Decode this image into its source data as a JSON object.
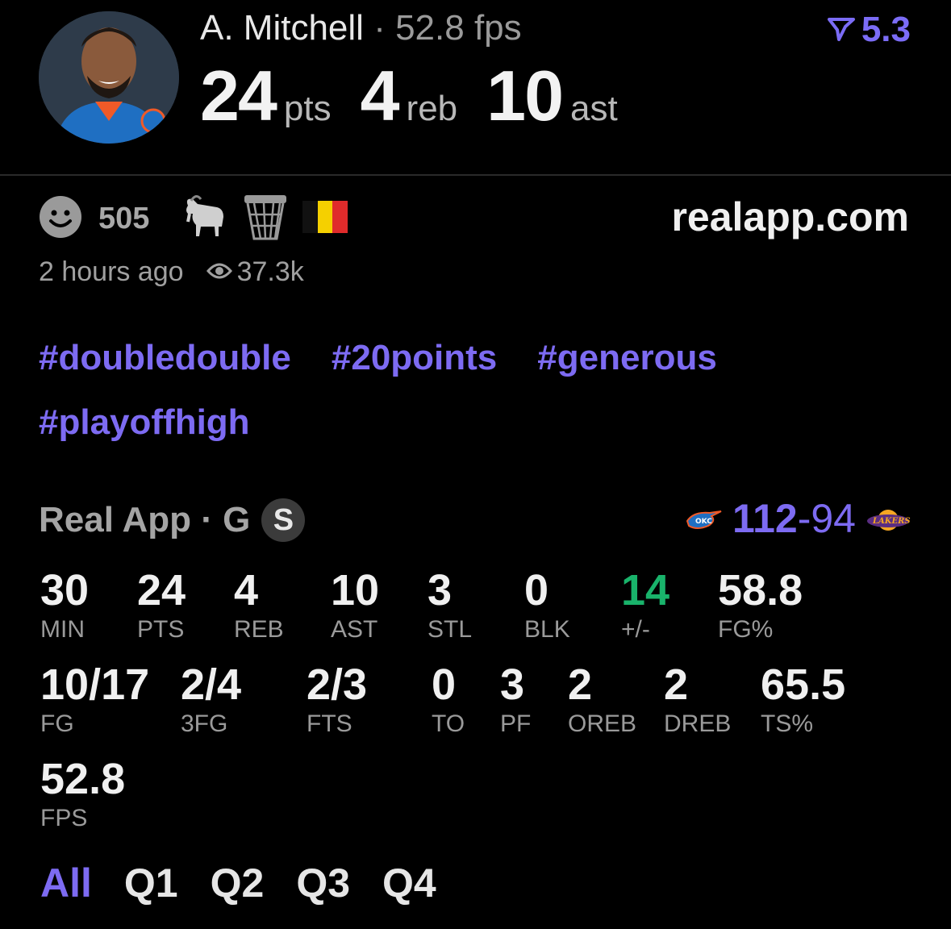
{
  "header": {
    "player_name": "A. Mitchell",
    "separator": "·",
    "fps_text": "52.8 fps",
    "badge_value": "5.3",
    "pts": "24",
    "pts_unit": "pts",
    "reb": "4",
    "reb_unit": "reb",
    "ast": "10",
    "ast_unit": "ast"
  },
  "reactions": {
    "count": "505",
    "icons": [
      "smiley-icon",
      "goat-icon",
      "basketball-hoop-icon",
      "belgium-flag-icon"
    ]
  },
  "site": "realapp.com",
  "meta": {
    "time": "2 hours ago",
    "views": "37.3k"
  },
  "tags": [
    "#doubledouble",
    "#20points",
    "#generous",
    "#playoffhigh"
  ],
  "source": {
    "label": "Real App · G",
    "badge": "S"
  },
  "game": {
    "team_score": "112",
    "dash": "-",
    "opp_score": "94"
  },
  "stats": {
    "row1": [
      {
        "v": "30",
        "l": "MIN"
      },
      {
        "v": "24",
        "l": "PTS"
      },
      {
        "v": "4",
        "l": "REB"
      },
      {
        "v": "10",
        "l": "AST"
      },
      {
        "v": "3",
        "l": "STL"
      },
      {
        "v": "0",
        "l": "BLK"
      },
      {
        "v": "14",
        "l": "+/-"
      },
      {
        "v": "58.8",
        "l": "FG%"
      }
    ],
    "row2": [
      {
        "v": "10/17",
        "l": "FG"
      },
      {
        "v": "2/4",
        "l": "3FG"
      },
      {
        "v": "2/3",
        "l": "FTS"
      },
      {
        "v": "0",
        "l": "TO"
      },
      {
        "v": "3",
        "l": "PF"
      },
      {
        "v": "2",
        "l": "OREB"
      },
      {
        "v": "2",
        "l": "DREB"
      },
      {
        "v": "65.5",
        "l": "TS%"
      }
    ],
    "row3": [
      {
        "v": "52.8",
        "l": "FPS"
      }
    ]
  },
  "periods": [
    "All",
    "Q1",
    "Q2",
    "Q3",
    "Q4"
  ],
  "colors": {
    "accent": "#7d6bf2",
    "positive": "#19b36b",
    "background": "#000000"
  }
}
